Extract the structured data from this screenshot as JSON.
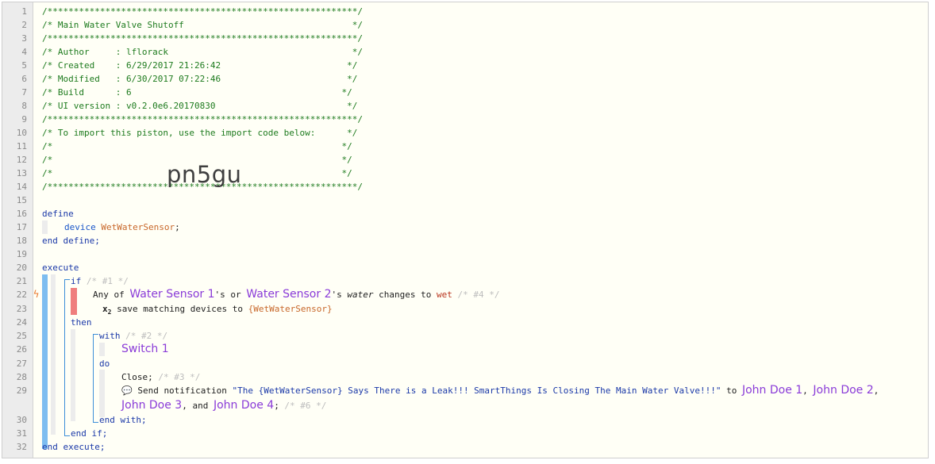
{
  "line_numbers": [
    "1",
    "2",
    "3",
    "4",
    "5",
    "6",
    "7",
    "8",
    "9",
    "10",
    "11",
    "12",
    "13",
    "14",
    "15",
    "16",
    "17",
    "18",
    "19",
    "20",
    "21",
    "22",
    "23",
    "24",
    "25",
    "26",
    "27",
    "28",
    "29",
    "30",
    "31",
    "32"
  ],
  "header_comment": {
    "border": "/***********************************************************/",
    "title": "/* Main Water Valve Shutoff                                */",
    "author": "/* Author     : lflorack                                   */",
    "created": "/* Created    : 6/29/2017 21:26:42                        */",
    "modified": "/* Modified   : 6/30/2017 07:22:46                        */",
    "build": "/* Build      : 6                                        */",
    "ui_version": "/* UI version : v0.2.0e6.20170830                         */",
    "import_note": "/* To import this piston, use the import code below:      */",
    "blank": "/*                                                       */",
    "import_code": "pn5gu"
  },
  "define_block": {
    "define_kw": "define",
    "device_kw": "device",
    "device_var": "WetWaterSensor",
    "semicolon": ";",
    "end_define": "end define;"
  },
  "execute_block": {
    "execute_kw": "execute",
    "if_kw": "if",
    "if_id": "/* #1 */",
    "condition": {
      "prefix": "Any of ",
      "device1": "Water Sensor 1",
      "possessive1": "'s or ",
      "device2": "Water Sensor 2",
      "possessive2": "'s ",
      "attribute": "water",
      "operator": " changes to ",
      "value": "wet",
      "cond_id": " /* #4 */"
    },
    "save_matching": {
      "x_symbol": "x",
      "x_sub": "2",
      "text": " save matching devices to ",
      "var": "{WetWaterSensor}"
    },
    "then_kw": "then",
    "with_kw": "with",
    "with_id": "/* #2 */",
    "switch_device": "Switch 1",
    "do_kw": "do",
    "close_cmd": "Close;",
    "close_id": " /* #3 */",
    "notification": {
      "icon": "💬",
      "prefix": " Send notification ",
      "message": "\"The {WetWaterSensor} Says There is a Leak!!! SmartThings Is Closing The Main Water Valve!!!\"",
      "to": " to ",
      "recipient1": "John Doe 1",
      "comma1": ", ",
      "recipient2": "John Doe 2",
      "comma2": ",",
      "recipient3": "John Doe 3",
      "and": ", and ",
      "recipient4": "John Doe 4",
      "end": ";",
      "id": " /* #6 */"
    },
    "end_with": "end with;",
    "end_if": "end if;",
    "end_execute": "end execute;"
  },
  "colors": {
    "comment": "#1e7b1e",
    "keyword": "#1b39a8",
    "device": "#8a3bd8",
    "variable": "#c8672a",
    "value": "#b8331c",
    "statement_bar": "#7dbdf0",
    "condition_bar": "#ef7e7e",
    "gutter": "#ececec"
  }
}
